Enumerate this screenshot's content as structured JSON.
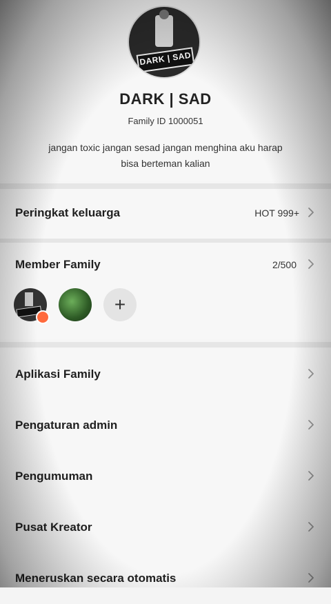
{
  "header": {
    "family_name": "DARK | SAD",
    "family_id": "Family ID 1000051",
    "description": "jangan toxic jangan sesad jangan menghina  aku harap bisa berteman kalian",
    "logo_text": "DARK | SAD"
  },
  "ranking": {
    "label": "Peringkat keluarga",
    "value": "HOT 999+"
  },
  "members": {
    "label": "Member Family",
    "count": "2/500",
    "add_symbol": "+"
  },
  "menu": [
    {
      "label": "Aplikasi Family"
    },
    {
      "label": "Pengaturan admin"
    },
    {
      "label": "Pengumuman"
    },
    {
      "label": "Pusat Kreator"
    },
    {
      "label": "Meneruskan secara otomatis"
    }
  ],
  "icons": {
    "chevron": "chevron-right-icon",
    "add": "plus-icon",
    "badge": "owner-badge-icon"
  },
  "colors": {
    "background": "#f7f7f7",
    "divider": "#e6e6e6",
    "badge": "#ff6a3d"
  }
}
